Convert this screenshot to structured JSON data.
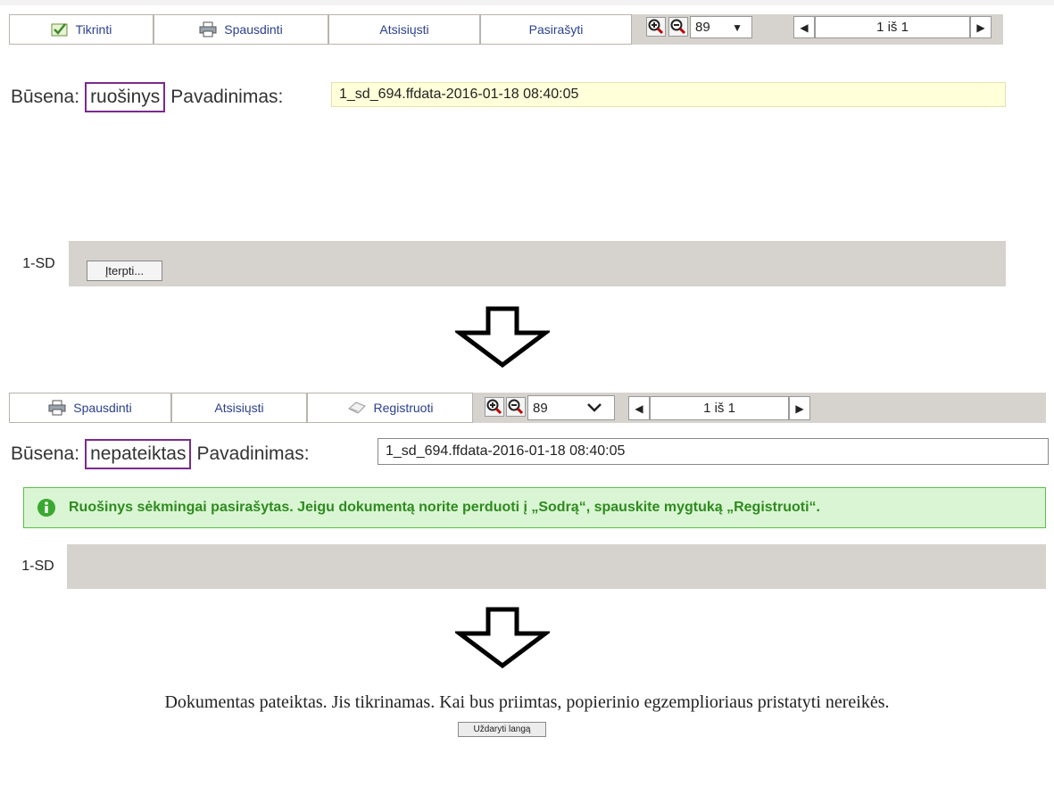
{
  "step1": {
    "toolbar": {
      "check_label": "Tikrinti",
      "print_label": "Spausdinti",
      "download_label": "Atsisiųsti",
      "sign_label": "Pasirašyti",
      "zoom_value": "89",
      "page_indicator": "1 iš 1"
    },
    "status_label": "Būsena:",
    "status_value": "ruošinys",
    "name_label": "Pavadinimas:",
    "name_value": "1_sd_694.ffdata-2016-01-18 08:40:05",
    "tab_label": "1-SD",
    "insert_button": "Įterpti..."
  },
  "step2": {
    "toolbar": {
      "print_label": "Spausdinti",
      "download_label": "Atsisiųsti",
      "register_label": "Registruoti",
      "zoom_value": "89",
      "page_indicator": "1 iš 1"
    },
    "status_label": "Būsena:",
    "status_value": "nepateiktas",
    "name_label": "Pavadinimas:",
    "name_value": "1_sd_694.ffdata-2016-01-18 08:40:05",
    "success_message": "Ruošinys sėkmingai pasirašytas. Jeigu dokumentą norite perduoti į „Sodrą“, spauskite mygtuką „Registruoti“.",
    "tab_label": "1-SD"
  },
  "step3": {
    "message": "Dokumentas pateiktas. Jis tikrinamas. Kai bus priimtas, popierinio egzemplioriaus pristatyti nereikės.",
    "close_button": "Uždaryti langą"
  },
  "colors": {
    "status_border": "#7a2a8c",
    "toolbar_bg": "#d6d3ce",
    "link_blue": "#2b3f8f",
    "success_bg": "#daf5d4",
    "success_border": "#59c04a",
    "success_text": "#2e8b1e",
    "name_input_bg": "#ffffd9"
  },
  "icons": [
    "check-icon",
    "printer-icon",
    "zoom-in-icon",
    "zoom-out-icon",
    "dropdown-arrow-icon",
    "prev-page-icon",
    "next-page-icon",
    "register-icon",
    "info-icon",
    "down-arrow-icon"
  ]
}
